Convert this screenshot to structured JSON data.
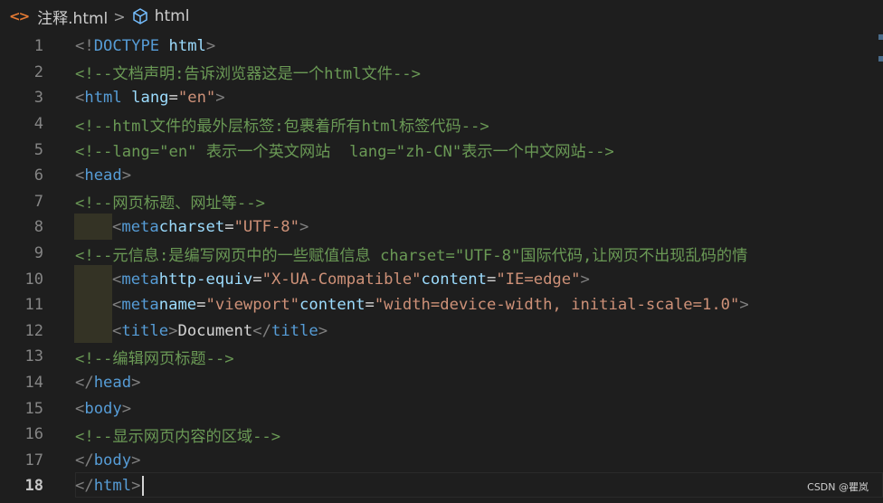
{
  "breadcrumb": {
    "file": "注释.html",
    "separator": ">",
    "symbol": "html"
  },
  "editor": {
    "current_line": 18,
    "lines": [
      {
        "n": "1"
      },
      {
        "n": "2"
      },
      {
        "n": "3"
      },
      {
        "n": "4"
      },
      {
        "n": "5"
      },
      {
        "n": "6"
      },
      {
        "n": "7"
      },
      {
        "n": "8"
      },
      {
        "n": "9"
      },
      {
        "n": "10"
      },
      {
        "n": "11"
      },
      {
        "n": "12"
      },
      {
        "n": "13"
      },
      {
        "n": "14"
      },
      {
        "n": "15"
      },
      {
        "n": "16"
      },
      {
        "n": "17"
      },
      {
        "n": "18"
      }
    ],
    "code": {
      "l1": {
        "open": "<!",
        "kw": "DOCTYPE",
        "sp": " ",
        "name": "html",
        "close": ">"
      },
      "l2": "<!--文档声明:告诉浏览器这是一个html文件-->",
      "l3": {
        "lt": "<",
        "tag": "html",
        "attr": "lang",
        "eq": "=",
        "val": "\"en\"",
        "gt": ">"
      },
      "l4": "<!--html文件的最外层标签:包裹着所有html标签代码-->",
      "l5": "<!--lang=\"en\" 表示一个英文网站  lang=\"zh-CN\"表示一个中文网站-->",
      "l6": {
        "lt": "<",
        "tag": "head",
        "gt": ">"
      },
      "l7": "<!--网页标题、网址等-->",
      "l8": {
        "lt": "<",
        "tag": "meta",
        "attr": "charset",
        "eq": "=",
        "val": "\"UTF-8\"",
        "gt": ">"
      },
      "l9": "<!--元信息:是编写网页中的一些赋值信息 charset=\"UTF-8\"国际代码,让网页不出现乱码的情",
      "l10": {
        "lt": "<",
        "tag": "meta",
        "attr1": "http-equiv",
        "eq": "=",
        "val1": "\"X-UA-Compatible\"",
        "attr2": "content",
        "val2": "\"IE=edge\"",
        "gt": ">"
      },
      "l11": {
        "lt": "<",
        "tag": "meta",
        "attr1": "name",
        "eq": "=",
        "val1": "\"viewport\"",
        "attr2": "content",
        "val2": "\"width=device-width, initial-scale=1.0\"",
        "gt": ">"
      },
      "l12": {
        "lt": "<",
        "tag": "title",
        "gt": ">",
        "text": "Document",
        "lts": "</",
        "gt2": ">"
      },
      "l13": "<!--编辑网页标题-->",
      "l14": {
        "lts": "</",
        "tag": "head",
        "gt": ">"
      },
      "l15": {
        "lt": "<",
        "tag": "body",
        "gt": ">"
      },
      "l16": "<!--显示网页内容的区域-->",
      "l17": {
        "lts": "</",
        "tag": "body",
        "gt": ">"
      },
      "l18": {
        "lts": "</",
        "tag": "html",
        "gt": ">"
      }
    }
  },
  "watermark": "CSDN @瞿岚",
  "colors": {
    "background": "#1e1e1e",
    "tag": "#569cd6",
    "attribute": "#9cdcfe",
    "string": "#ce9178",
    "comment": "#6a9955",
    "punctuation": "#808080",
    "line_number": "#858585",
    "html_icon": "#e37933"
  }
}
